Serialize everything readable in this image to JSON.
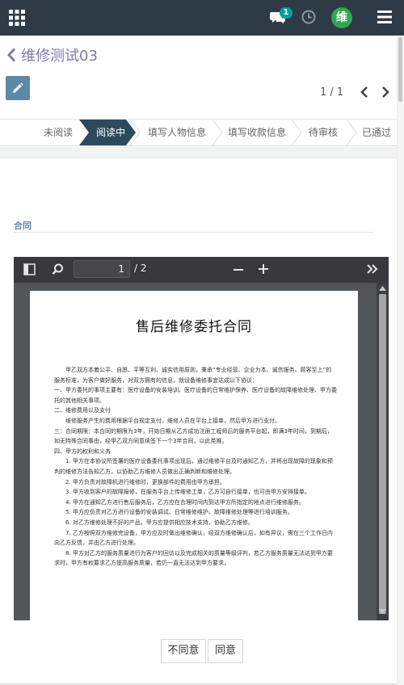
{
  "navbar": {
    "chat_badge": "1",
    "user_initial": "维",
    "icons": [
      "apps-icon",
      "chat-icon",
      "clock-icon",
      "avatar",
      "hamburger-menu-icon"
    ]
  },
  "breadcrumb": {
    "title": "维修测试03"
  },
  "pager": {
    "value": "1 / 1"
  },
  "statusbar": {
    "stages": [
      {
        "label": "未阅读",
        "active": false
      },
      {
        "label": "阅读中",
        "active": true
      },
      {
        "label": "填写人物信息",
        "active": false
      },
      {
        "label": "填写收款信息",
        "active": false
      },
      {
        "label": "待审核",
        "active": false
      },
      {
        "label": "已通过",
        "active": false
      }
    ]
  },
  "section": {
    "label": "合同"
  },
  "pdf": {
    "page_input": "1",
    "page_total": "/ 2",
    "doc_title": "售后维修委托合同",
    "paragraphs": [
      {
        "indent": true,
        "text": "甲乙双方本着公平、自愿、平等互利、诚实信用原则，秉承“专业经营、企业为本、诚信服务、顾客至上”的服务标准，为客户做好服务，对双方拥有的信息，就设备维修事宜达成以下协议："
      },
      {
        "indent": false,
        "text": "一、甲方委托的事项主要有：医疗设备的安装培训、医疗设备的日常维护保养、医疗设备的故障维修处理、甲方委托的其他相关事项。"
      },
      {
        "indent": false,
        "text": "二、维修费用以及支付"
      },
      {
        "indent": true,
        "text": "维修服务产生的费用根据平台规定支付，维修人员在平台上接单，然后甲方进行支付。"
      },
      {
        "indent": false,
        "text": "三：合同期限：本合同的期限为3年，开始日期从乙方成功注册工程师后的服务平台起，即满3年时间，到期后，如无特殊合同事由，经甲乙双方同意续签下一个3年合同，以此类推。"
      },
      {
        "indent": false,
        "text": "四、甲方的权利和义务"
      },
      {
        "indent": true,
        "text": "1. 甲方在本协议所签署的医疗设备委托事项出现后，通过维修平台及时通知乙方，并将出现故障的现象和预判的维修方法告知乙方，以协助乙方维修人员做出正确判断和维修处理。"
      },
      {
        "indent": true,
        "text": "2. 甲方负责对故障机进行维修时，更换部件的费用由甲方承担。"
      },
      {
        "indent": true,
        "text": "3. 甲方收到客户的故障报修，在服务平台上传维修工单，乙方可自行接单，也可由甲方安排接单。"
      },
      {
        "indent": true,
        "text": "4. 甲方在通知乙方进行售后服务后，乙方应在合理时间内到达甲方所指定的地点进行维修服务。"
      },
      {
        "indent": true,
        "text": "5. 甲方应负责对乙方进行设备的安装调试、日常维修维护、故障维修处理等进行培训服务。"
      },
      {
        "indent": true,
        "text": "6. 对乙方维修处理不好的产品，甲方应提供相应技术支持，协助乙方维修。"
      },
      {
        "indent": true,
        "text": "7. 乙方按照双方维修完设备，甲方应及时做出维修确认，经双方维修确认后，如有异议，需在三个工作日内向乙方反馈，并由乙方进行处理。"
      },
      {
        "indent": true,
        "text": "8. 甲方对乙方的服务质量进行为客户的回访以及完成相关的质量等级评判，若乙方服务质量无法达到甲方要求时，甲方有权要求乙方提高服务质量，若仍一直无法达到甲方要求，"
      }
    ]
  },
  "buttons": {
    "disagree": "不同意",
    "agree": "同意"
  }
}
